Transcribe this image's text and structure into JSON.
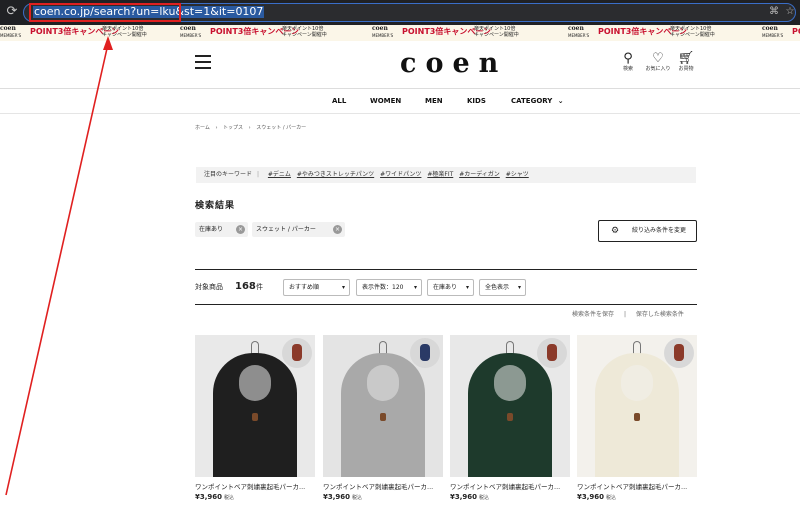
{
  "browser": {
    "url": "coen.co.jp/search?un=lku&st=1&it=0107"
  },
  "banner": {
    "brand_line1": "coen",
    "brand_line2": "MEMBER'S",
    "point": "POINT3倍キャンペーン",
    "note_line1": "楽天ポイント10倍",
    "note_line2": "キャンペーン開催中"
  },
  "header": {
    "logo": "coen",
    "search_label": "検索",
    "favorites_label": "お気に入り",
    "cart_label": "お買物"
  },
  "nav": {
    "items": [
      "ALL",
      "WOMEN",
      "MEN",
      "KIDS"
    ],
    "category_label": "CATEGORY"
  },
  "breadcrumb": [
    "ホーム",
    "トップス",
    "スウェット / パーカー"
  ],
  "keywords": {
    "label": "注目のキーワード",
    "tags": [
      "#デニム",
      "#やみつきストレッチパンツ",
      "#ワイドパンツ",
      "#極楽FIT",
      "#カーディガン",
      "#シャツ"
    ]
  },
  "search": {
    "title": "検索結果",
    "chips": [
      "在庫あり",
      "スウェット / パーカー"
    ],
    "refine_button": "絞り込み条件を変更"
  },
  "results": {
    "count_label": "対象商品",
    "count": "168",
    "count_unit": "件",
    "sort": "おすすめ順",
    "per_page": "表示件数：120",
    "stock": "在庫あり",
    "color": "全色表示",
    "save_condition": "検索条件を保存",
    "saved_conditions": "保存した検索条件"
  },
  "products": [
    {
      "name": "ワンポイントベア刺繍裏起毛パーカ...",
      "price": "¥3,960",
      "tax": "税込",
      "color": "#1f1f1f",
      "bg": "#e9e9e9"
    },
    {
      "name": "ワンポイントベア刺繍裏起毛パーカ...",
      "price": "¥3,960",
      "tax": "税込",
      "color": "#a9a9a9",
      "bg": "#e4e4e4"
    },
    {
      "name": "ワンポイントベア刺繍裏起毛パーカ...",
      "price": "¥3,960",
      "tax": "税込",
      "color": "#1e3a2c",
      "bg": "#e8e8e8"
    },
    {
      "name": "ワンポイントベア刺繍裏起毛パーカ...",
      "price": "¥3,960",
      "tax": "税込",
      "color": "#eee9d8",
      "bg": "#f3f1ec"
    }
  ],
  "colors": {
    "accent_red": "#c8102e",
    "annotation_red": "#e02020"
  }
}
